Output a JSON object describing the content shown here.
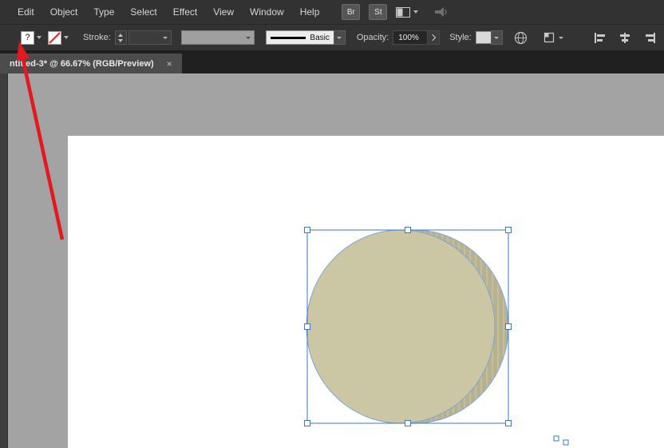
{
  "menu": {
    "items": [
      "Edit",
      "Object",
      "Type",
      "Select",
      "Effect",
      "View",
      "Window",
      "Help"
    ],
    "br_label": "Br",
    "st_label": "St"
  },
  "control_bar": {
    "fill_value": "?",
    "stroke_label": "Stroke:",
    "stroke_style": "Basic",
    "opacity_label": "Opacity:",
    "opacity_value": "100%",
    "style_label": "Style:"
  },
  "tab": {
    "title": "ntitled-3* @ 66.67% (RGB/Preview)",
    "close_glyph": "×"
  },
  "colors": {
    "selection_blue": "#3b77d1",
    "shape_outline_blue": "#7fa3d8",
    "shape_fill": "#cbc7a4",
    "shape_side": "#b6b18e",
    "annotation_red": "#e2191f",
    "artboard_white": "#ffffff",
    "pasteboard_gray": "#a3a3a3"
  }
}
